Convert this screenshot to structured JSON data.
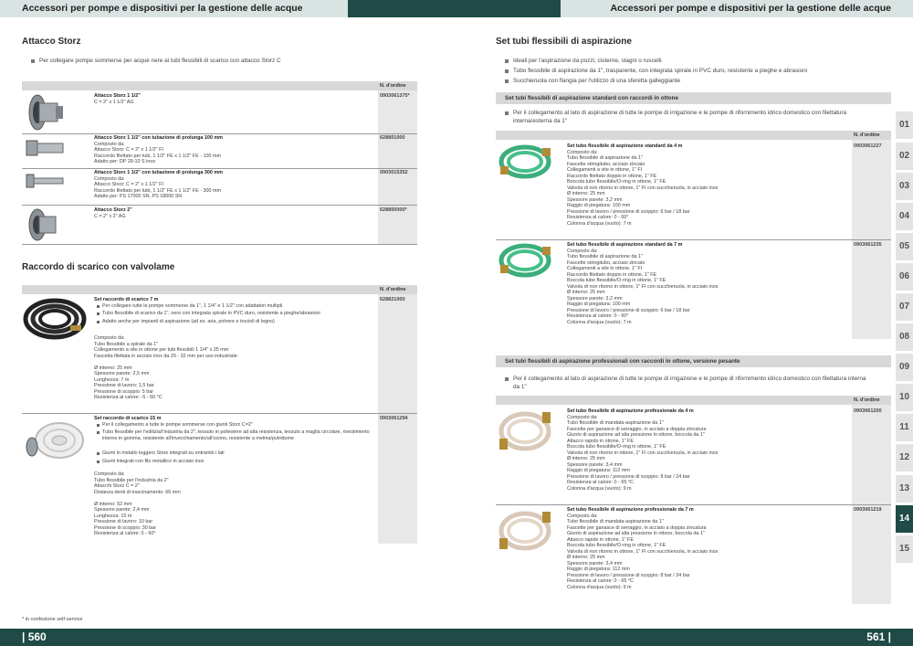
{
  "header": {
    "left_title": "Accessori per pompe e dispositivi per la gestione delle acque",
    "right_title": "Accessori per pompe e dispositivi per la gestione delle acque"
  },
  "footer": {
    "left_page": "| 560",
    "right_page": "561 |",
    "note": "* in confezione self-service"
  },
  "col_header": "N. d'ordine",
  "storz": {
    "title": "Attacco Storz",
    "bullet": "Per collegare pompe sommerse per acque nere ai tubi flessibili di scarico con attacco Storz C",
    "items": [
      {
        "name": "Attacco Storz 1 1/2\"",
        "body": "C = 2\" x 1 1/2\" AG",
        "code": "0903061375*"
      },
      {
        "name": "Attacco Storz 1 1/2\" con tubazione di prolunga 100 mm",
        "body": "Composto da:\nAttacco Storz: C = 2\" x 1 1/2\" FI\nRaccordo filettato per tubi, 1 1/2\" FE x 1 1/2\" FE - 100 mm\nAdatto per: DP 28-10 S inox",
        "code": "628801000"
      },
      {
        "name": "Attacco Storz 1 1/2\" con tubazione di prolunga 300 mm",
        "body": "Composto da:\nAttacco Storz: C = 2\" x 1 1/2\" FI\nRaccordo filettato per tubi, 1 1/2\" FE x 1 1/2\" FE - 300 mm\nAdatto per: PS 17000 SN, PS 18000 SN",
        "code": "0903015352"
      },
      {
        "name": "Attacco Storz 2\"",
        "body": "C = 2\" x 2\" AG",
        "code": "628800000*"
      }
    ]
  },
  "raccordo": {
    "title": "Raccordo di scarico con valvolame",
    "items": [
      {
        "name": "Set raccordo di scarico 7 m",
        "bullets": [
          "Per collegare tutte le pompe sommerse da 1\", 1 1/4\" e 1 1/2\" con adattatori multipli",
          "Tubo flessibile di scarico da 1\", nero con integrata spirale in PVC duro, resistente a pieghe/abrasioni",
          "Adatto anche per impianti di aspirazione (ad es. aria, polvere e trucioli di legno)"
        ],
        "body": "Composto da:\nTubo flessibile a spirale da 1\"\nCollegamento a vite in ottone per tubi flessibili 1 1/4\" x 25 mm\nFascetta filettata in acciaio inox da 20 - 32 mm per uso industriale\n\nØ interno: 25 mm\nSpessore parete: 2,5 mm\nLunghezza: 7 m\nPressione di lavoro: 1,5 bar\nPressione di scoppio: 5 bar\nResistenza al calore: -5 - 60 °C",
        "code": "628821000"
      },
      {
        "name": "Set raccordo di scarico 15 m",
        "bullets": [
          "Per il collegamento a tutte le pompe sommerse con giunti Storz C=2\"",
          "Tubo flessibile per l'edilizia/l'industria da 2\", tessuto in poliestere ad alta resistenza, tessuto a maglia circolare, rivestimento interno in gomma, resistente all'invecchiamento/all'ozono, resistente a melma/putridume",
          "Giunti in metallo leggero Storz integrati su entrambi i lati",
          "Giunti integrati con filo metallico in acciaio inox"
        ],
        "body": "Composto da:\nTubo flessibile per l'industria da 2\"\nAttacchi Storz C = 2\"\nDistanza denti di trascinamento: 66 mm\n\nØ interno: 52 mm\nSpessore parete: 2,4 mm\nLunghezza: 15 m\nPressione di lavoro: 10 bar\nPressione di scoppio: 30 bar\nResistenza al calore: 0 - 60°",
        "code": "0903061294"
      }
    ]
  },
  "set_tubi": {
    "title": "Set tubi flessibili di aspirazione",
    "bullets": [
      "Ideali per l'aspirazione da pozzi, cisterne, stagni o ruscelli",
      "Tubo flessibile di aspirazione da 1\", trasparente, con integrata spirale in PVC duro, resistente a pieghe e abrasioni",
      "Succhieruola con flangia per l'utilizzo di una sferetta galleggiante"
    ],
    "standard": {
      "title": "Set tubi flessibili di aspirazione standard con raccordi in ottone",
      "bullet": "Per il collegamento al lato di aspirazione di tutte le pompe di irrigazione e le pompe di rifornimento idrico domestico con filettatura interna/esterna da 1\"",
      "items": [
        {
          "name": "Set tubo flessibile di aspirazione standard da 4 m",
          "body": "Composto da:\nTubo flessibile di aspirazione da 1\"\nFascette stringitubo, acciaio zincato\nCollegamenti a vite in ottone, 1\" FI\nRaccordo filettato doppio in ottone, 1\" FE\nBoccola tubo flessibile/O-ring in ottone, 1\" FE\nValvola di non ritorno in ottone, 1\" FI con succhieruola, in acciaio inox\nØ interno: 25 mm\nSpessore parete: 3,2 mm\nRaggio di piegatura: 100 mm\nPressione di lavoro / pressione di scoppio: 6 bar / 18 bar\nResistenza al calore: 0 - 60°\nColonna d'acqua (vuoto): 7 m",
          "code": "0903061227"
        },
        {
          "name": "Set tubo flessibile di aspirazione standard da 7 m",
          "body": "Composto da:\nTubo flessibile di aspirazione da 1\"\nFascette stringitubo, acciaio zincato\nCollegamenti a vite in ottone, 1\" FI\nRaccordo filettato doppio in ottone, 1\" FE\nBoccola tubo flessibile/O-ring in ottone, 1\" FE\nValvola di non ritorno in ottone, 1\" FI con succhieruola, in acciaio inox\nØ interno: 25 mm\nSpessore parete: 3,2 mm\nRaggio di piegatura: 100 mm\nPressione di lavoro / pressione di scoppio: 6 bar / 18 bar\nResistenza al calore: 0 - 60°\nColonna d'acqua (vuoto): 7 m",
          "code": "0903061235"
        }
      ]
    },
    "pro": {
      "title": "Set tubi flessibili di aspirazione professionali con raccordi in ottone, versione pesante",
      "bullet": "Per il collegamento al lato di aspirazione di tutte le pompe di irrigazione e le pompe di rifornimento idrico domestico con filettatura interna da 1\"",
      "items": [
        {
          "name": "Set tubo flessibile di aspirazione professionale da 4 m",
          "body": "Composto da:\nTubo flessibile di mandata-aspirazione da 1\"\nFascette per ganasce di serraggio, in acciaio a doppia zincatura\nGiunto di aspirazione ad alta pressione in ottone, boccola da 1\"\nAttacco rapido in ottone, 1\" FE\nBoccola tubo flessibile/O-ring in ottone, 1\" FE\nValvola di non ritorno in ottone, 1\" FI con succhieruola, in acciaio inox\nØ interno: 25 mm\nSpessore parete: 3,4 mm\nRaggio di piegatura: 112 mm\nPressione di lavoro / pressione di scoppio: 8 bar / 24 bar\nResistenza al calore: 0 - 65 °C\nColonna d'acqua (vuoto): 9 m",
          "code": "0903061200"
        },
        {
          "name": "Set tubo flessibile di aspirazione professionale da 7 m",
          "body": "Composto da:\nTubo flessibile di mandata-aspirazione da 1\"\nFascette per ganasce di serraggio, in acciaio a doppia zincatura\nGiunto di aspirazione ad alta pressione in ottone, boccola da 1\"\nAttacco rapido in ottone, 1\" FE\nBoccola tubo flessibile/O-ring in ottone, 1\" FE\nValvola di non ritorno in ottone, 1\" FI con succhieruola, in acciaio inox\nØ interno: 25 mm\nSpessore parete: 3,4 mm\nRaggio di piegatura: 112 mm\nPressione di lavoro / pressione di scoppio: 8 bar / 24 bar\nResistenza al calore: 0 - 65 °C\nColonna d'acqua (vuoto): 9 m",
          "code": "0903061219"
        }
      ]
    }
  },
  "tabs": [
    "01",
    "02",
    "03",
    "04",
    "05",
    "06",
    "07",
    "08",
    "09",
    "10",
    "11",
    "12",
    "13",
    "14",
    "15"
  ],
  "active_tab": "14"
}
